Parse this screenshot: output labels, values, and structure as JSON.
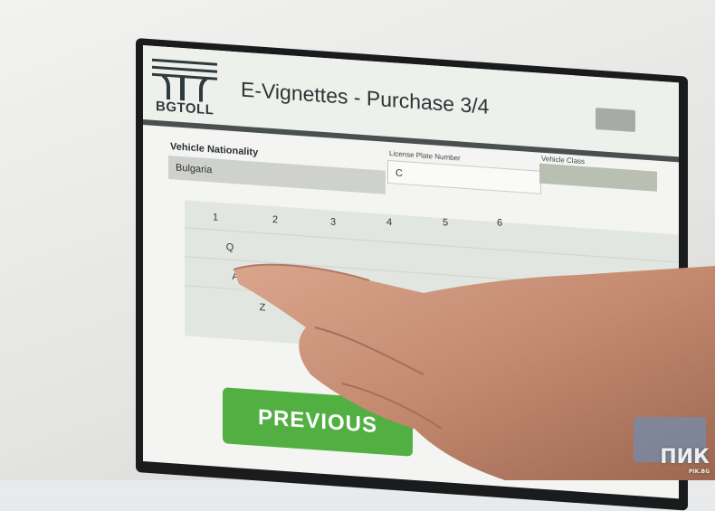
{
  "header": {
    "logo_text": "BGTOLL",
    "title": "E-Vignettes - Purchase 3/4"
  },
  "form": {
    "vehicle_nationality_label": "Vehicle Nationality",
    "vehicle_nationality_value": "Bulgaria",
    "license_plate_label": "License Plate Number",
    "license_plate_value": "C",
    "vehicle_class_label": "Vehicle Class"
  },
  "keyboard": {
    "visible_keys": [
      "1",
      "2",
      "3",
      "4",
      "5",
      "6",
      "Q",
      "A",
      "Z"
    ]
  },
  "buttons": {
    "previous_label": "PREVIOUS"
  },
  "watermark": {
    "text": "ПИК",
    "sub": "PIK.BG"
  },
  "colors": {
    "header_bar": "#4a4f4f",
    "previous_button": "#52b043",
    "field_bg": "#cfd1cd"
  }
}
